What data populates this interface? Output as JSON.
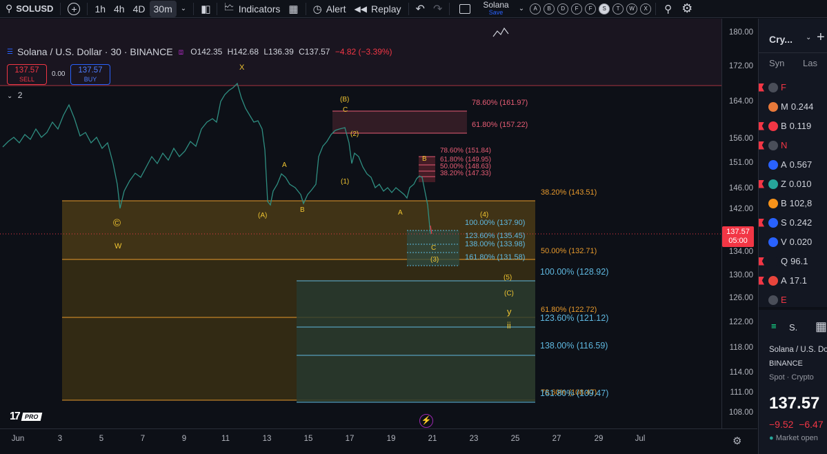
{
  "toolbar": {
    "symbol": "SOLUSD",
    "intervals": [
      "1h",
      "4h",
      "4D",
      "30m"
    ],
    "active_interval": "30m",
    "indicators_label": "Indicators",
    "alert_label": "Alert",
    "replay_label": "Replay",
    "layout_name": "Solana",
    "layout_save": "Save",
    "letter_buttons": [
      "A",
      "B",
      "D",
      "F",
      "F",
      "S",
      "T",
      "W",
      "X"
    ],
    "active_letter": "S"
  },
  "legend": {
    "title": "Solana / U.S. Dollar · 30 · BINANCE",
    "open": "O142.35",
    "high": "H142.68",
    "low": "L136.39",
    "close": "C137.57",
    "change": "−4.82 (−3.39%)",
    "sell_price": "137.57",
    "sell_label": "SELL",
    "spread": "0.00",
    "buy_price": "137.57",
    "buy_label": "BUY",
    "collapse_count": "2"
  },
  "price_scale": [
    "180.00",
    "172.00",
    "164.00",
    "156.00",
    "151.00",
    "146.00",
    "142.00",
    "138.00",
    "134.00",
    "130.00",
    "126.00",
    "122.00",
    "118.00",
    "114.00",
    "111.00",
    "108.00"
  ],
  "current_price": {
    "price": "137.57",
    "countdown": "05:00"
  },
  "time_scale": [
    "Jun",
    "3",
    "5",
    "7",
    "9",
    "11",
    "13",
    "15",
    "17",
    "19",
    "21",
    "23",
    "25",
    "27",
    "29",
    "Jul"
  ],
  "fib_labels": {
    "upper_1": "78.60% (161.97)",
    "upper_2": "61.80% (157.22)",
    "mid_1": "78.60% (151.84)",
    "mid_2": "61.80% (149.95)",
    "mid_3": "50.00% (148.63)",
    "mid_4": "38.20% (147.33)",
    "big_1": "38.20% (143.51)",
    "big_2": "50.00% (132.71)",
    "big_3": "61.80% (122.72)",
    "big_4": "78.60% (108.47)",
    "ext_1": "100.00% (137.90)",
    "ext_2": "123.60% (135.45)",
    "ext_3": "138.00% (133.98)",
    "ext_4": "161.80% (131.58)",
    "ext2_1": "100.00% (128.92)",
    "ext2_2": "123.60% (121.12)",
    "ext2_3": "138.00% (116.59)",
    "ext2_4": "161.80% (109.47)"
  },
  "wave_labels": {
    "x": "X",
    "w": "W",
    "c_circle": "©",
    "A1": "A",
    "A1_paren": "(A)",
    "B1": "B",
    "B_paren": "(B)",
    "C_top": "C",
    "w2": "(2)",
    "w1": "(1)",
    "A2": "A",
    "B2": "B",
    "w4": "(4)",
    "C2": "C",
    "w3": "(3)",
    "w5": "(5)",
    "C_paren": "(C)",
    "y": "y",
    "ii": "ii"
  },
  "logo_text": "PRO",
  "watchlist": {
    "title": "Cry...",
    "col_symbol": "Syn",
    "col_last": "Las",
    "rows": [
      {
        "sym": "F",
        "price": "",
        "flag": true,
        "icon_color": "#4a4e59"
      },
      {
        "sym": "M",
        "price": "0.244",
        "flag": false,
        "icon_color": "#e8793a"
      },
      {
        "sym": "B",
        "price": "0.119",
        "flag": true,
        "icon_color": "#f23645"
      },
      {
        "sym": "N",
        "price": "",
        "flag": true,
        "icon_color": "#4a4e59"
      },
      {
        "sym": "A",
        "price": "0.567",
        "flag": false,
        "icon_color": "#2962ff"
      },
      {
        "sym": "Z",
        "price": "0.010",
        "flag": true,
        "icon_color": "#26a69a"
      },
      {
        "sym": "B",
        "price": "102,8",
        "flag": false,
        "icon_color": "#f7931a"
      },
      {
        "sym": "S",
        "price": "0.242",
        "flag": true,
        "icon_color": "#2962ff"
      },
      {
        "sym": "V",
        "price": "0.020",
        "flag": false,
        "icon_color": "#2962ff"
      },
      {
        "sym": "Q",
        "price": "96.1",
        "flag": true,
        "icon_color": "#131722"
      },
      {
        "sym": "A",
        "price": "17.1",
        "flag": true,
        "icon_color": "#e8453c"
      },
      {
        "sym": "E",
        "price": "",
        "flag": false,
        "icon_color": "#4a4e59"
      }
    ],
    "detail_symbol": "S.",
    "detail_name": "Solana / U.S. Do",
    "detail_exchange": "BINANCE",
    "detail_type": "Spot · Crypto",
    "detail_price": "137.57",
    "detail_change": "−9.52  −6.47",
    "detail_status": "Market open"
  },
  "colors": {
    "up": "#26a69a",
    "down": "#f23645",
    "fib_orange": "#e89a2c",
    "fib_red": "#e85d75",
    "fib_cyan": "#5fb8e0",
    "wave_yellow": "#f0c531"
  }
}
